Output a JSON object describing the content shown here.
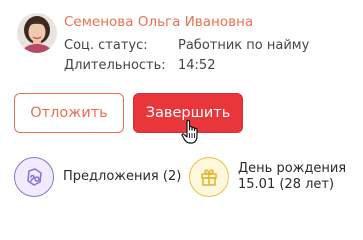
{
  "person": {
    "name": "Семенова Ольга Ивановна",
    "avatar_icon": "avatar-photo"
  },
  "details": [
    {
      "label": "Соц. статус:",
      "value": "Работник по найму"
    },
    {
      "label": "Длительность:",
      "value": "14:52"
    }
  ],
  "actions": {
    "postpone_label": "Отложить",
    "finish_label": "Завершить"
  },
  "info": {
    "offers_label": "Предложения (2)",
    "offers_icon": "offers-icon",
    "birthday_title": "День рождения",
    "birthday_value": "15.01 (28 лет)",
    "birthday_icon": "gift-icon"
  },
  "colors": {
    "accent": "#e8714f",
    "finish": "#e8363a",
    "offers_icon": "#8a71d6",
    "birthday_icon": "#e8c244"
  }
}
